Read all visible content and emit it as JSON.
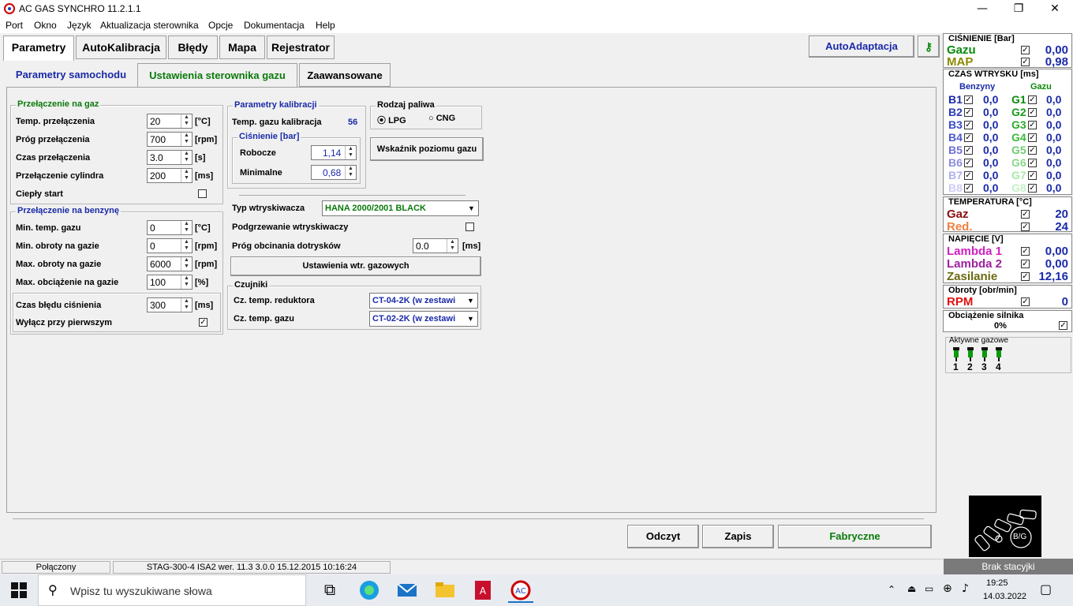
{
  "app": {
    "title": "AC GAS SYNCHRO  11.2.1.1"
  },
  "menu": [
    "Port",
    "Okno",
    "Język",
    "Aktualizacja sterownika",
    "Opcje",
    "Dokumentacja",
    "Help"
  ],
  "main_tabs": [
    "Parametry",
    "AutoKalibracja",
    "Błędy",
    "Mapa",
    "Rejestrator"
  ],
  "autoadaptacja": "AutoAdaptacja",
  "sub_tabs": [
    "Parametry samochodu",
    "Ustawienia sterownika gazu",
    "Zaawansowane"
  ],
  "przelaczenie_gaz": {
    "title": "Przełączenie na gaz",
    "rows": [
      {
        "label": "Temp. przełączenia",
        "value": "20",
        "unit": "[°C]"
      },
      {
        "label": "Próg przełączenia",
        "value": "700",
        "unit": "[rpm]"
      },
      {
        "label": "Czas przełączenia",
        "value": "3.0",
        "unit": "[s]"
      },
      {
        "label": "Przełączenie cylindra",
        "value": "200",
        "unit": "[ms]"
      }
    ],
    "cieply_start": "Ciepły start"
  },
  "przelaczenie_benzyna": {
    "title": "Przełączenie na benzynę",
    "rows": [
      {
        "label": "Min. temp. gazu",
        "value": "0",
        "unit": "[°C]"
      },
      {
        "label": "Min. obroty na gazie",
        "value": "0",
        "unit": "[rpm]"
      },
      {
        "label": "Max. obroty na gazie",
        "value": "6000",
        "unit": "[rpm]"
      },
      {
        "label": "Max. obciążenie na gazie",
        "value": "100",
        "unit": "[%]"
      }
    ],
    "czas_bledu": {
      "label": "Czas błędu ciśnienia",
      "value": "300",
      "unit": "[ms]"
    },
    "wylacz": "Wyłącz przy pierwszym"
  },
  "kalibracja": {
    "title": "Parametry kalibracji",
    "temp_label": "Temp. gazu kalibracja",
    "temp_value": "56",
    "cisnienie_title": "Ciśnienie [bar]",
    "robocze_label": "Robocze",
    "robocze_value": "1,14",
    "minimalne_label": "Minimalne",
    "minimalne_value": "0,68"
  },
  "paliwo": {
    "title": "Rodzaj paliwa",
    "lpg": "LPG",
    "cng": "CNG",
    "wskaznik": "Wskaźnik poziomu gazu"
  },
  "wtryski": {
    "typ_label": "Typ wtryskiwacza",
    "typ_value": "HANA 2000/2001 BLACK",
    "podgrzewanie": "Podgrzewanie wtryskiwaczy",
    "prog_label": "Próg obcinania dotrysków",
    "prog_value": "0.0",
    "prog_unit": "[ms]",
    "ustawienia_btn": "Ustawienia wtr. gazowych"
  },
  "czujniki": {
    "title": "Czujniki",
    "reduktor_label": "Cz. temp. reduktora",
    "reduktor_value": "CT-04-2K (w zestawi",
    "gaz_label": "Cz. temp. gazu",
    "gaz_value": "CT-02-2K (w zestawi"
  },
  "buttons": {
    "odczyt": "Odczyt",
    "zapis": "Zapis",
    "fabryczne": "Fabryczne"
  },
  "status": {
    "state": "Połączony",
    "device": "STAG-300-4 ISA2  wer. 11.3  3.0.0    15.12.2015 10:16:24"
  },
  "right": {
    "cisnienie": {
      "title": "CIŚNIENIE [Bar]",
      "gazu_label": "Gazu",
      "gazu_value": "0,00",
      "map_label": "MAP",
      "map_value": "0,98"
    },
    "czas": {
      "title": "CZAS WTRYSKU  [ms]",
      "benzyny": "Benzyny",
      "gazu": "Gazu",
      "rows": [
        {
          "b": "B1",
          "bv": "0,0",
          "g": "G1",
          "gv": "0,0"
        },
        {
          "b": "B2",
          "bv": "0,0",
          "g": "G2",
          "gv": "0,0"
        },
        {
          "b": "B3",
          "bv": "0,0",
          "g": "G3",
          "gv": "0,0"
        },
        {
          "b": "B4",
          "bv": "0,0",
          "g": "G4",
          "gv": "0,0"
        },
        {
          "b": "B5",
          "bv": "0,0",
          "g": "G5",
          "gv": "0,0"
        },
        {
          "b": "B6",
          "bv": "0,0",
          "g": "G6",
          "gv": "0,0"
        },
        {
          "b": "B7",
          "bv": "0,0",
          "g": "G7",
          "gv": "0,0"
        },
        {
          "b": "B8",
          "bv": "0,0",
          "g": "G8",
          "gv": "0,0"
        }
      ]
    },
    "temperatura": {
      "title": "TEMPERATURA  [°C]",
      "gaz_label": "Gaz",
      "gaz_value": "20",
      "red_label": "Red.",
      "red_value": "24"
    },
    "napiecie": {
      "title": "NAPIĘCIE [V]",
      "l1_label": "Lambda 1",
      "l1_value": "0,00",
      "l2_label": "Lambda 2",
      "l2_value": "0,00",
      "zas_label": "Zasilanie",
      "zas_value": "12,16"
    },
    "obroty": {
      "title": "Obroty [obr/min]",
      "rpm_label": "RPM",
      "rpm_value": "0"
    },
    "obciazenie": {
      "title": "Obciążenie silnika",
      "value": "0%"
    },
    "aktywne": {
      "title": "Aktywne gazowe",
      "nums": [
        "1",
        "2",
        "3",
        "4"
      ]
    },
    "brak": "Brak stacyjki",
    "bg": "B/G"
  },
  "taskbar": {
    "search": "Wpisz tu wyszukiwane słowa",
    "time": "19:25",
    "date": "14.03.2022"
  }
}
